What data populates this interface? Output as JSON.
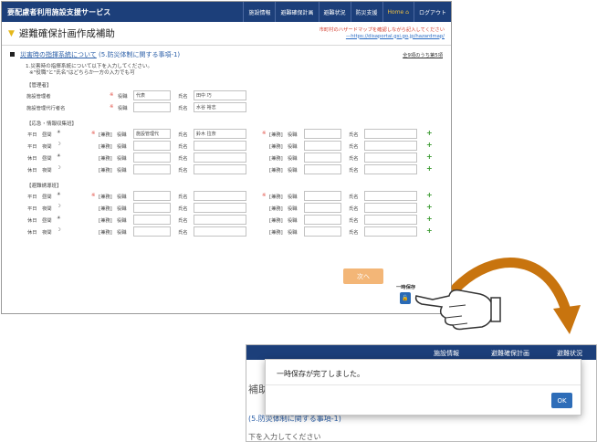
{
  "header": {
    "brand": "要配慮者利用施設支援サービス",
    "nav": [
      "施設情報",
      "避難確保計画",
      "避難状況",
      "防災支援",
      "Home",
      "ログアウト"
    ]
  },
  "page": {
    "title": "避難確保計画作成補助",
    "hazard_note": "市町村のハザードマップを確認しながら記入してください",
    "hazard_link": "—https://disaportal.gsi.go.jp/hazardmap/",
    "section_label": "災害時の指揮系統について",
    "section_ref": "(5.防災体制に関する事項-1)",
    "progress": "全9項のうち第5項",
    "note1": "1.災害時の指揮系統について以下を入力してください。",
    "note2": "※\"役職\"と\"氏名\"はどちらか一方の入力でも可"
  },
  "labels": {
    "yakushoku": "役職",
    "shimei": "氏名",
    "kenmu": "[兼務]",
    "req": "※"
  },
  "groups": {
    "g1": "【管理者】",
    "g2": "【応急・情報収集班】",
    "g3": "【避難誘導班】"
  },
  "manager_rows": [
    {
      "label": "施設管理者",
      "yaku": "代表",
      "shimei": "田中 巧"
    },
    {
      "label": "施設管理代行者名",
      "yaku": "",
      "shimei": "水谷 裕志"
    }
  ],
  "shift_labels": [
    {
      "day": "平日",
      "time": "昼間",
      "icon": "sun"
    },
    {
      "day": "平日",
      "time": "夜間",
      "icon": "moon"
    },
    {
      "day": "休日",
      "time": "昼間",
      "icon": "sun"
    },
    {
      "day": "休日",
      "time": "夜間",
      "icon": "moon"
    }
  ],
  "info_rows": [
    {
      "yaku": "施設管理代",
      "shimei": "鈴木 拉奈"
    },
    {
      "yaku": "",
      "shimei": ""
    },
    {
      "yaku": "",
      "shimei": ""
    },
    {
      "yaku": "",
      "shimei": ""
    }
  ],
  "evac_rows": [
    {
      "yaku": "",
      "shimei": ""
    },
    {
      "yaku": "",
      "shimei": ""
    },
    {
      "yaku": "",
      "shimei": ""
    },
    {
      "yaku": "",
      "shimei": ""
    }
  ],
  "buttons": {
    "next": "次へ",
    "temp_save": "一時保存",
    "ok": "OK"
  },
  "dialog": {
    "message": "一時保存が完了しました。",
    "bg_nav": [
      "施設情報",
      "避難確保計画",
      "避難状況"
    ],
    "bg_title": "補助",
    "bg_section": "(5.防災体制に関する事項-1)",
    "bg_note": "下を入力してください"
  },
  "colors": {
    "header": "#1c3f7a",
    "accent_orange": "#f3b677",
    "ok_button": "#2e6db8",
    "plus": "#3a9a30"
  }
}
